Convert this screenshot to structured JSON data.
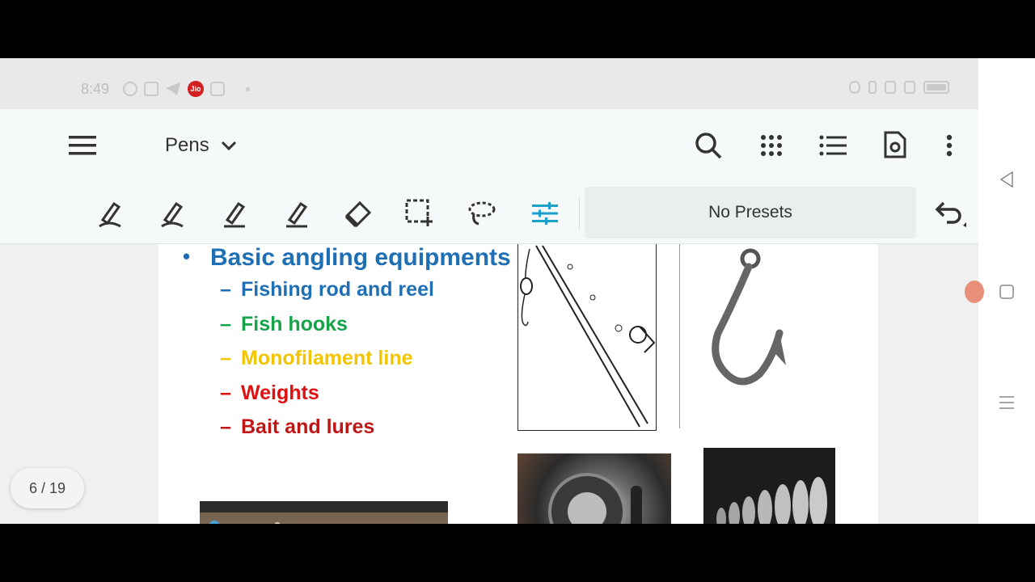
{
  "status_bar": {
    "time": "8:49",
    "jio_label": "Jio"
  },
  "top_bar": {
    "mode_label": "Pens"
  },
  "toolbar": {
    "presets_label": "No Presets"
  },
  "slide": {
    "main_bullet": "Basic angling equipments",
    "sub_items": [
      {
        "text": "Fishing rod and reel",
        "color": "#1f6fb5"
      },
      {
        "text": "Fish hooks",
        "color": "#17a34a"
      },
      {
        "text": "Monofilament line",
        "color": "#f2c500"
      },
      {
        "text": "Weights",
        "color": "#e01010"
      },
      {
        "text": "Bait and lures",
        "color": "#c01515"
      }
    ]
  },
  "page_indicator": "6 / 19",
  "colors": {
    "accent": "#1aa0c9",
    "main_bullet": "#1f6fb5"
  }
}
